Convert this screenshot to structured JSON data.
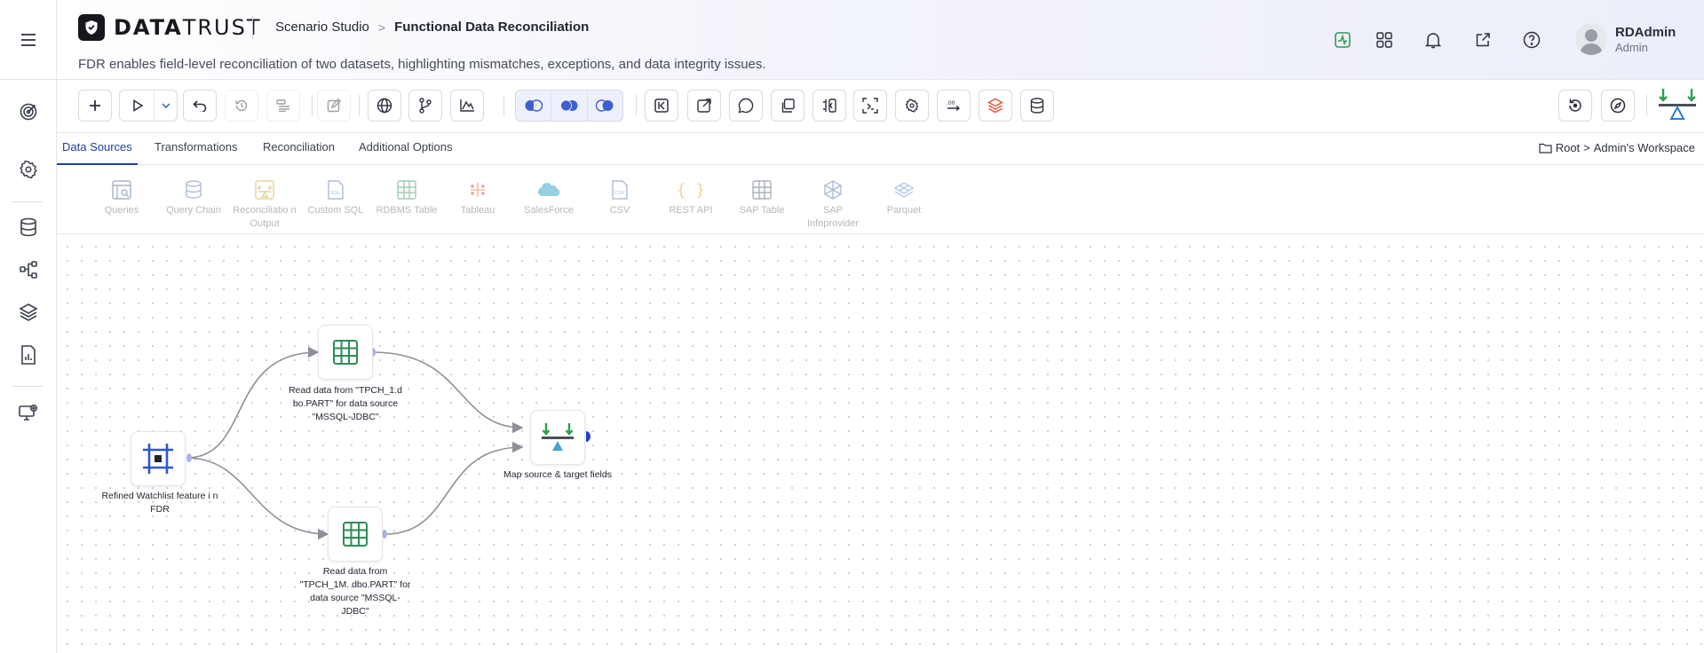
{
  "brand": {
    "strong": "DATA",
    "light": "TRUST"
  },
  "breadcrumb": {
    "studio": "Scenario Studio",
    "separator": ">",
    "current": "Functional Data Reconciliation"
  },
  "subtitle": "FDR enables field-level reconciliation of two datasets, highlighting mismatches, exceptions, and data integrity issues.",
  "header_icons": [
    "activity-icon",
    "apps-grid-icon",
    "bell-icon",
    "open-external-icon",
    "help-icon"
  ],
  "user": {
    "name": "RDAdmin",
    "role": "Admin"
  },
  "left_nav": [
    "menu-icon",
    "target-icon",
    "settings-icon",
    "database-icon",
    "hierarchy-icon",
    "layers-icon",
    "report-icon",
    "monitor-settings-icon"
  ],
  "toolbar": {
    "buttons": [
      "add",
      "run",
      "run-options",
      "undo",
      "history",
      "list",
      "edit",
      "globe",
      "branch",
      "chart",
      "join-left",
      "join-inner",
      "join-right",
      "first",
      "export",
      "comment",
      "copy",
      "split",
      "scan",
      "settings",
      "counter",
      "stack",
      "storage",
      "refresh-history",
      "compass",
      "reconcile"
    ]
  },
  "tabs": [
    {
      "label": "Data Sources",
      "active": true
    },
    {
      "label": "Transformations",
      "active": false
    },
    {
      "label": "Reconciliation",
      "active": false
    },
    {
      "label": "Additional Options",
      "active": false
    }
  ],
  "workspace": {
    "root": "Root",
    "separator": ">",
    "name": "Admin's Workspace"
  },
  "palette": [
    {
      "label": "Queries",
      "icon": "queries-icon"
    },
    {
      "label": "Query Chain",
      "icon": "query-chain-icon"
    },
    {
      "label": "Reconciliatio n Output",
      "icon": "reconciliation-output-icon"
    },
    {
      "label": "Custom SQL",
      "icon": "custom-sql-icon"
    },
    {
      "label": "RDBMS Table",
      "icon": "rdbms-table-icon"
    },
    {
      "label": "Tableau",
      "icon": "tableau-icon"
    },
    {
      "label": "SalesForce",
      "icon": "salesforce-icon"
    },
    {
      "label": "CSV",
      "icon": "csv-icon"
    },
    {
      "label": "REST API",
      "icon": "rest-api-icon"
    },
    {
      "label": "SAP Table",
      "icon": "sap-table-icon"
    },
    {
      "label": "SAP Infoprovider",
      "icon": "sap-infoprovider-icon"
    },
    {
      "label": "Parquet",
      "icon": "parquet-icon"
    }
  ],
  "flow": {
    "nodes": [
      {
        "id": "start",
        "label": "Refined Watchlist feature i n FDR",
        "icon": "frame-icon"
      },
      {
        "id": "source1",
        "label": "Read data from \"TPCH_1.d bo.PART\" for data source \"MSSQL-JDBC\"",
        "icon": "table-icon"
      },
      {
        "id": "source2",
        "label": "Read data from \"TPCH_1M. dbo.PART\" for data source \"MSSQL-JDBC\"",
        "icon": "table-icon"
      },
      {
        "id": "map",
        "label": "Map source & target fields",
        "icon": "reconcile-icon"
      }
    ],
    "edges": [
      [
        "start",
        "source1"
      ],
      [
        "start",
        "source2"
      ],
      [
        "source1",
        "map"
      ],
      [
        "source2",
        "map"
      ]
    ]
  },
  "colors": {
    "accent": "#1e3f9e",
    "green": "#2e9e54",
    "canvas_dot": "#c9ccd4"
  }
}
